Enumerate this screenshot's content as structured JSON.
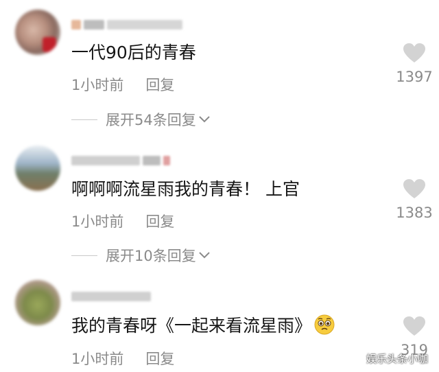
{
  "comments": [
    {
      "text": "一代90后的青春",
      "time": "1小时前",
      "reply_label": "回复",
      "likes": "1397",
      "expand_label": "展开54条回复"
    },
    {
      "text": "啊啊啊流星雨我的青春！ 上官",
      "time": "1小时前",
      "reply_label": "回复",
      "likes": "1383",
      "expand_label": "展开10条回复"
    },
    {
      "text": "我的青春呀《一起来看流星雨》",
      "time": "1小时前",
      "reply_label": "回复",
      "likes": "319",
      "emoji": "pleading-face-emoji"
    }
  ],
  "watermark": "娱乐头条小咖",
  "colors": {
    "text": "#161616",
    "meta": "#8a8a8a",
    "heart": "#d3d3d3"
  }
}
